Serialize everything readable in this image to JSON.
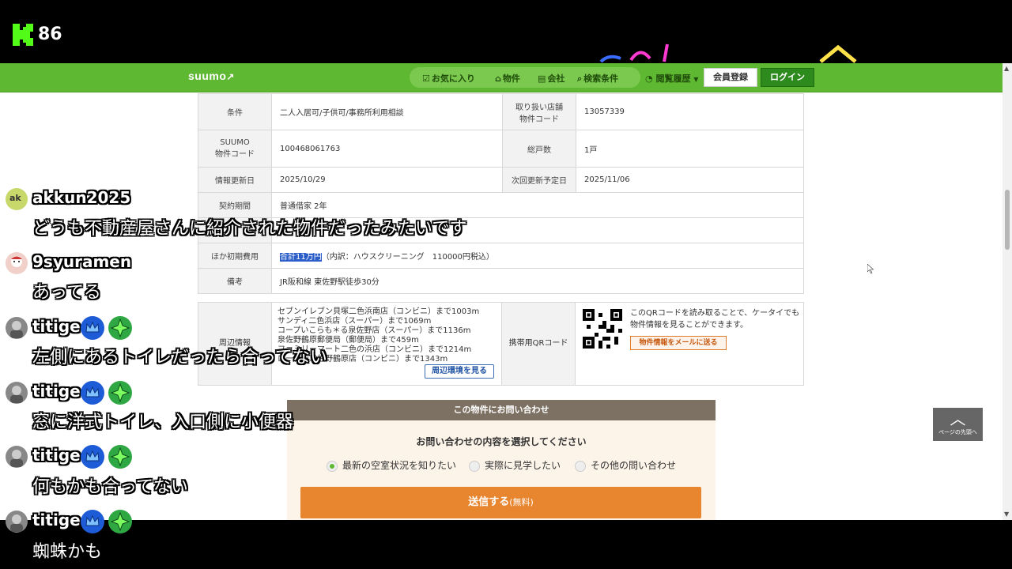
{
  "stream": {
    "viewer_count": "86"
  },
  "header": {
    "logo": "suumo",
    "nav": [
      "お気に入り",
      "物件",
      "会社",
      "検索条件"
    ],
    "history": "閲覧履歴",
    "member_button": "会員登録",
    "login_button": "ログイン"
  },
  "table": {
    "r1": {
      "h1": "条件",
      "v1": "二人入居可/子供可/事務所利用相談",
      "h2a": "取り扱い店舗",
      "h2b": "物件コード",
      "v2": "13057339"
    },
    "r2": {
      "h1a": "SUUMO",
      "h1b": "物件コード",
      "v1": "100468061763",
      "h2": "総戸数",
      "v2": "1戸"
    },
    "r3": {
      "h1": "情報更新日",
      "v1": "2025/10/29",
      "h2": "次回更新予定日",
      "v2": "2025/11/06"
    },
    "r4": {
      "h1": "契約期間",
      "v1": "普通借家 2年"
    },
    "r5": {
      "h1": "",
      "v1": ""
    },
    "r6": {
      "h1": "ほか初期費用",
      "v1_hl": "合計11万円",
      "v1_rest": "（内訳：ハウスクリーニング　110000円税込）"
    },
    "r7": {
      "h1": "備考",
      "v1": "JR阪和線 東佐野駅徒歩30分"
    }
  },
  "env": {
    "label": "周辺情報",
    "lines": [
      "セブンイレブン貝塚二色浜南店（コンビニ）まで1003m",
      "サンディ二色浜店（スーパー）まで1069m",
      "コープいこらも＊る泉佐野店（スーパー）まで1136m",
      "泉佐野鶴原郵便局（郵便局）まで459m",
      "ファミリーマート二色の浜店（コンビニ）まで1214m",
      "ローソン泉佐野鶴原店（コンビニ）まで1343m"
    ],
    "env_button": "周辺環境を見る",
    "qr_label": "携帯用QRコード",
    "qr_text": "このQRコードを読み取ることで、ケータイでも物件情報を見ることができます。",
    "mail_button": "物件情報をメールに送る"
  },
  "inquiry": {
    "title": "この物件にお問い合わせ",
    "subtitle": "お問い合わせの内容を選択してください",
    "options": [
      "最新の空室状況を知りたい",
      "実際に見学したい",
      "その他の問い合わせ"
    ],
    "send": "送信する",
    "send_small": "(無料)"
  },
  "page_top": "ページの先頭へ",
  "chat": [
    {
      "user": "akkun2025",
      "text": "どうも不動産屋さんに紹介された物件だったみたいです"
    },
    {
      "user": "9syuramen",
      "text": "あってる"
    },
    {
      "user": "titige",
      "text": "左側にあるトイレだったら合ってない"
    },
    {
      "user": "titige",
      "text": "窓に洋式トイレ、入口側に小便器"
    },
    {
      "user": "titige",
      "text": "何もかも合ってない"
    },
    {
      "user": "titige",
      "text": "蜘蛛かも"
    }
  ],
  "colors": {
    "suumo_green": "#5fb832",
    "kick_green": "#53fc18",
    "send_orange": "#e8852f"
  }
}
